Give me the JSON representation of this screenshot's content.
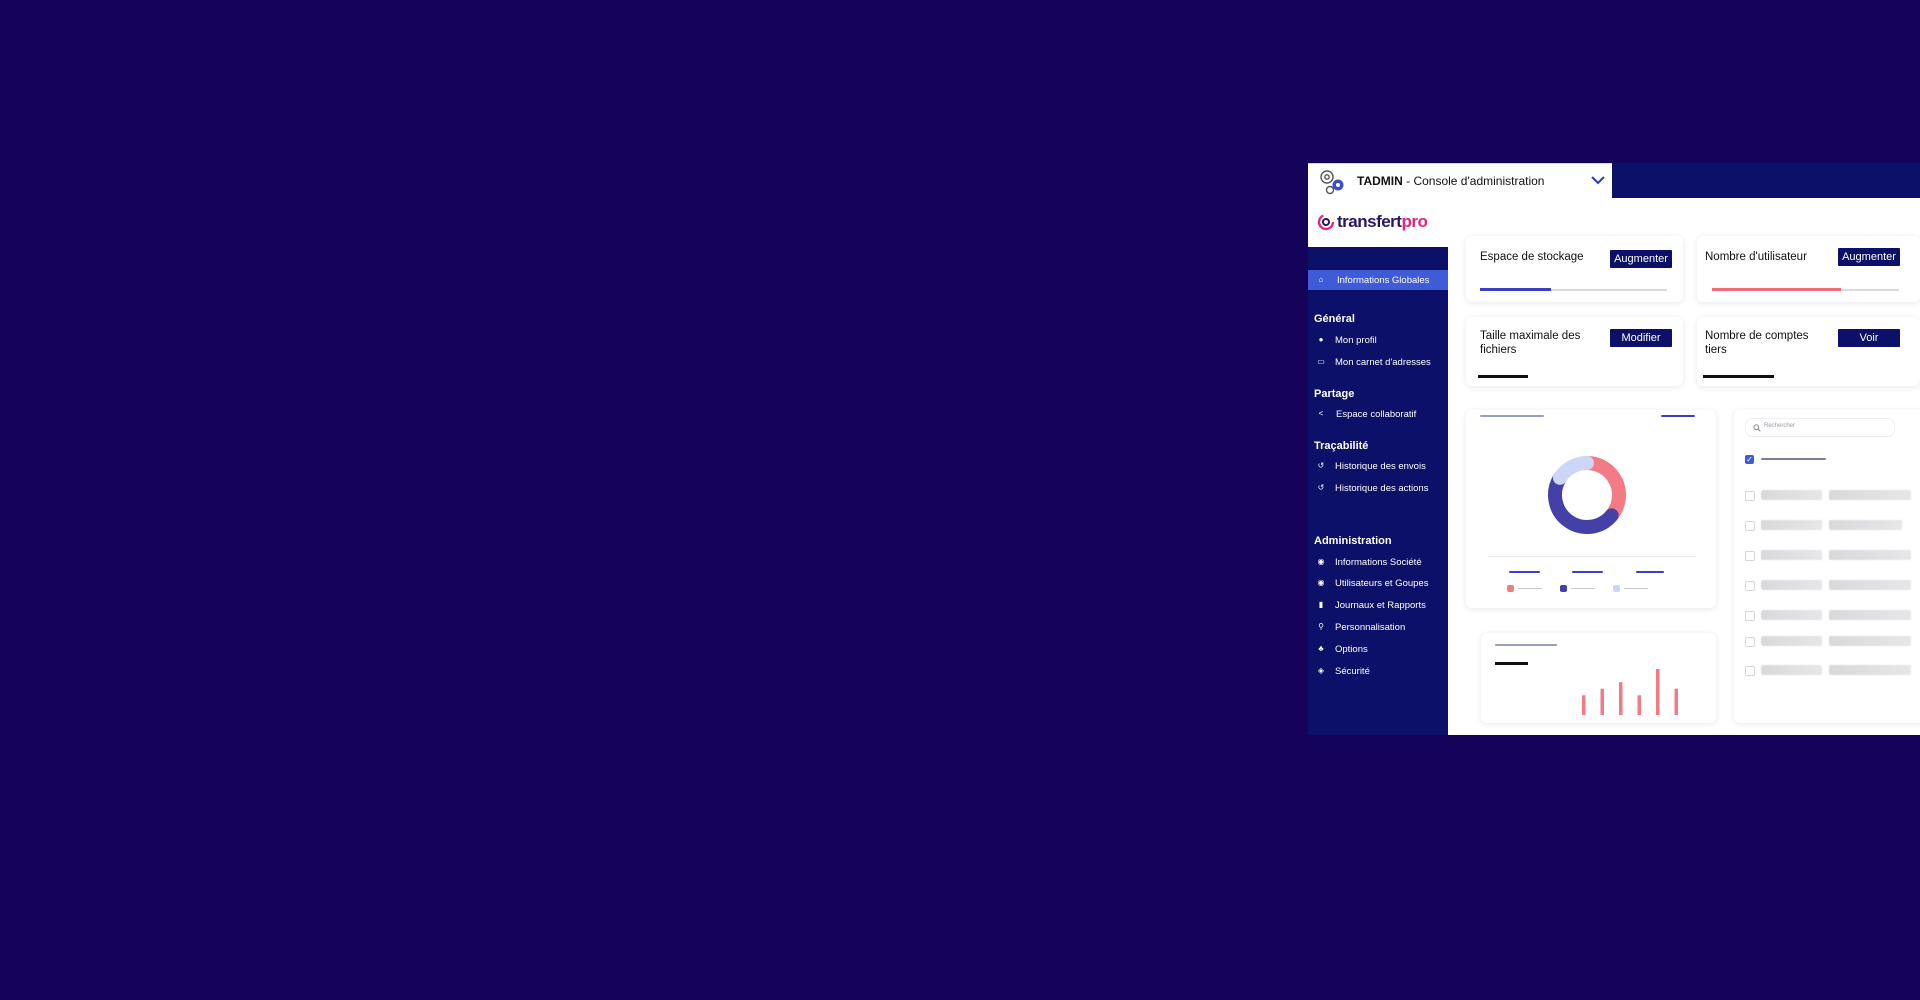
{
  "header": {
    "app_name": "TADMIN",
    "app_subtitle": " - Console d'administration",
    "logo_main": "transfert",
    "logo_accent": "pro",
    "menu_icon": "chevron-down-icon",
    "brand_icon": "gears-icon"
  },
  "sidebar": {
    "active": {
      "label": "Informations Globales",
      "icon": "home-icon"
    },
    "sections": [
      {
        "title": "Général",
        "items": [
          {
            "label": "Mon profil",
            "icon": "user-icon"
          },
          {
            "label": "Mon carnet d'adresses",
            "icon": "address-card-icon"
          }
        ]
      },
      {
        "title": "Partage",
        "items": [
          {
            "label": "Espace collaboratif",
            "icon": "share-icon"
          }
        ]
      },
      {
        "title": "Traçabilité",
        "items": [
          {
            "label": "Historique des envois",
            "icon": "history-icon"
          },
          {
            "label": "Historique des actions",
            "icon": "history-icon"
          }
        ]
      },
      {
        "title": "Administration",
        "items": [
          {
            "label": "Informations Société",
            "icon": "building-icon"
          },
          {
            "label": "Utilisateurs et Goupes",
            "icon": "users-icon"
          },
          {
            "label": "Journaux et Rapports",
            "icon": "file-icon"
          },
          {
            "label": "Personnalisation",
            "icon": "brush-icon"
          },
          {
            "label": "Options",
            "icon": "sliders-icon"
          },
          {
            "label": "Sécurité",
            "icon": "shield-icon"
          }
        ]
      }
    ]
  },
  "cards": {
    "storage": {
      "title": "Espace de stockage",
      "button": "Augmenter",
      "progress": 0.38,
      "color": "#3b3fc4"
    },
    "users": {
      "title": "Nombre d'utilisateur",
      "button": "Augmenter",
      "progress": 0.69,
      "color": "#ef6b78"
    },
    "filesize": {
      "title": "Taille maximale des fichiers",
      "button": "Modifier"
    },
    "accounts": {
      "title": "Nombre de comptes tiers",
      "button": "Voir"
    }
  },
  "search": {
    "placeholder": "Rechercher",
    "icon": "search-icon"
  },
  "chart_data": [
    {
      "type": "pie",
      "title": "",
      "slices": [
        {
          "color": "#f27b85",
          "value": 36
        },
        {
          "color": "#4540a8",
          "value": 48
        },
        {
          "color": "#cdd6f6",
          "value": 16
        }
      ]
    },
    {
      "type": "bar",
      "title": "",
      "values": [
        3,
        4,
        5,
        3,
        7,
        4
      ],
      "color": "#f27b85"
    }
  ],
  "colors": {
    "brand_navy": "#0c1068",
    "accent_blue": "#3f5bd8",
    "accent_pink": "#e0287a",
    "background": "#15035a"
  }
}
